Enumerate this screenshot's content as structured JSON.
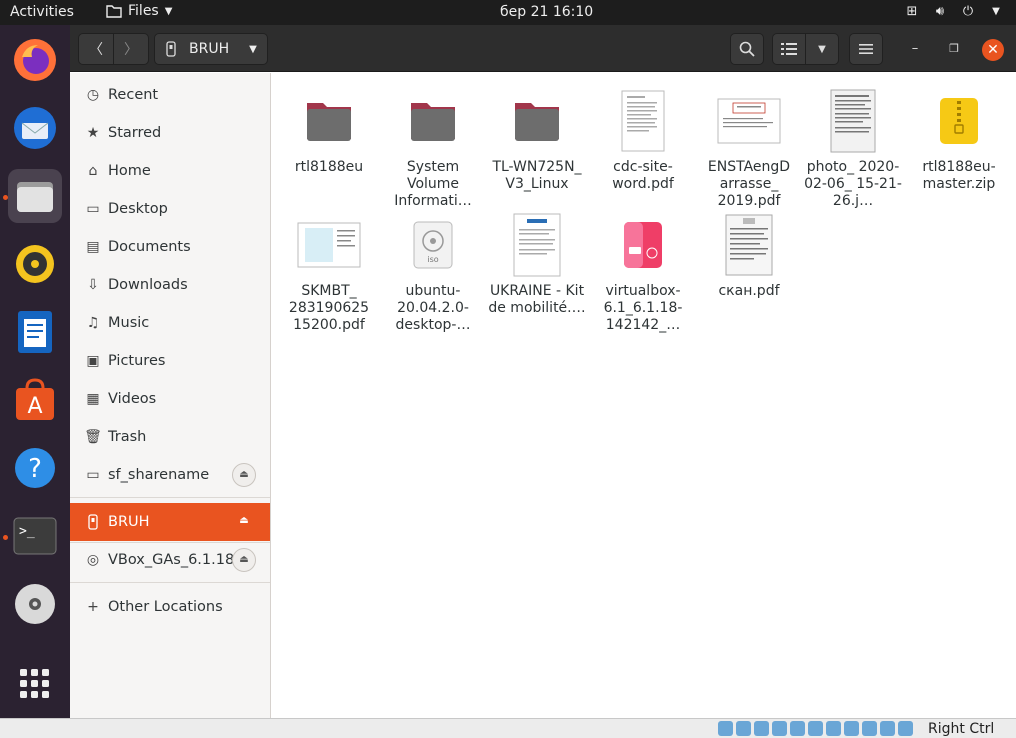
{
  "topbar": {
    "activities": "Activities",
    "app_menu": "Files",
    "clock": "бер 21  16:10"
  },
  "dock": {
    "items": [
      {
        "icon": "firefox-icon"
      },
      {
        "icon": "thunderbird-icon"
      },
      {
        "icon": "files-icon"
      },
      {
        "icon": "rhythmbox-icon"
      },
      {
        "icon": "writer-icon"
      },
      {
        "icon": "software-icon"
      },
      {
        "icon": "help-icon"
      },
      {
        "icon": "terminal-icon"
      },
      {
        "icon": "dvd-icon"
      },
      {
        "icon": "show-apps-icon"
      }
    ]
  },
  "header": {
    "path_label": "BRUH"
  },
  "sidebar": {
    "items": [
      {
        "label": "Recent",
        "icon": "clock-icon"
      },
      {
        "label": "Starred",
        "icon": "star-icon"
      },
      {
        "label": "Home",
        "icon": "home-icon"
      },
      {
        "label": "Desktop",
        "icon": "desktop-icon"
      },
      {
        "label": "Documents",
        "icon": "documents-icon"
      },
      {
        "label": "Downloads",
        "icon": "downloads-icon"
      },
      {
        "label": "Music",
        "icon": "music-icon"
      },
      {
        "label": "Pictures",
        "icon": "pictures-icon"
      },
      {
        "label": "Videos",
        "icon": "videos-icon"
      },
      {
        "label": "Trash",
        "icon": "trash-icon"
      },
      {
        "label": "sf_sharename",
        "icon": "drive-icon"
      }
    ],
    "devices": [
      {
        "label": "BRUH",
        "icon": "usb-icon"
      },
      {
        "label": "VBox_GAs_6.1.18",
        "icon": "disc-icon"
      }
    ],
    "other": {
      "label": "Other Locations",
      "icon": "plus-icon"
    }
  },
  "files": [
    {
      "name": "rtl8188eu",
      "kind": "folder"
    },
    {
      "name": "System Volume Informati…",
      "kind": "folder"
    },
    {
      "name": "TL-WN725N_ V3_Linux",
      "kind": "folder"
    },
    {
      "name": "cdc-site-word.pdf",
      "kind": "document"
    },
    {
      "name": "ENSTAengD arrasse_ 2019.pdf",
      "kind": "pdf-landscape"
    },
    {
      "name": "photo_ 2020-02-06_ 15-21-26.j…",
      "kind": "photo"
    },
    {
      "name": "rtl8188eu-master.zip",
      "kind": "zip"
    },
    {
      "name": "SKMBT_ 283190625 15200.pdf",
      "kind": "scan"
    },
    {
      "name": "ubuntu-20.04.2.0-desktop-…",
      "kind": "iso"
    },
    {
      "name": "UKRAINE - Kit de mobilité.…",
      "kind": "document2"
    },
    {
      "name": "virtualbox-6.1_6.1.18-142142_…",
      "kind": "deb"
    },
    {
      "name": "скан.pdf",
      "kind": "scan2"
    }
  ],
  "statusbar": {
    "host_key": "Right Ctrl"
  },
  "colors": {
    "accent": "#e95420",
    "folder": "#6d6d6d",
    "folder_tab": "#a1364b",
    "zip": "#f6c915",
    "deb": "#ef3e67"
  }
}
